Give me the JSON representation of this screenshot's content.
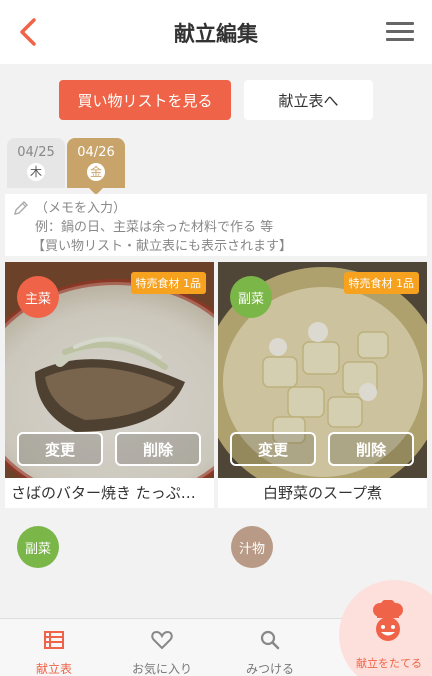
{
  "header": {
    "title": "献立編集"
  },
  "actions": {
    "shopping_list_label": "買い物リストを見る",
    "menu_table_label": "献立表へ"
  },
  "dates": [
    {
      "date": "04/25",
      "weekday": "木",
      "selected": false
    },
    {
      "date": "04/26",
      "weekday": "金",
      "selected": true
    }
  ],
  "memo": {
    "placeholder": "（メモを入力）",
    "example_line": "例：鍋の日、主菜は余った材料で作る 等",
    "note_line": "【買い物リスト・献立表にも表示されます】"
  },
  "dishes": [
    {
      "category": "主菜",
      "category_color": "#ef6448",
      "sale_badge": "特売食材 1品",
      "name": "さばのバター焼き たっぷ…",
      "change_label": "変更",
      "delete_label": "削除"
    },
    {
      "category": "副菜",
      "category_color": "#7ab648",
      "sale_badge": "特売食材 1品",
      "name": "白野菜のスープ煮",
      "change_label": "変更",
      "delete_label": "削除"
    }
  ],
  "empty_slots": [
    {
      "category": "副菜",
      "color": "#7ab648"
    },
    {
      "category": "汁物",
      "color": "#b89a86"
    }
  ],
  "tabbar": {
    "items": [
      {
        "label": "献立表",
        "icon": "list-icon",
        "active": true
      },
      {
        "label": "お気に入り",
        "icon": "heart-icon",
        "active": false
      },
      {
        "label": "みつける",
        "icon": "search-icon",
        "active": false
      }
    ],
    "cook_button_label": "献立をたてる"
  },
  "colors": {
    "accent": "#ef6448",
    "date_selected": "#c9a46a",
    "sale": "#f7a21e"
  }
}
